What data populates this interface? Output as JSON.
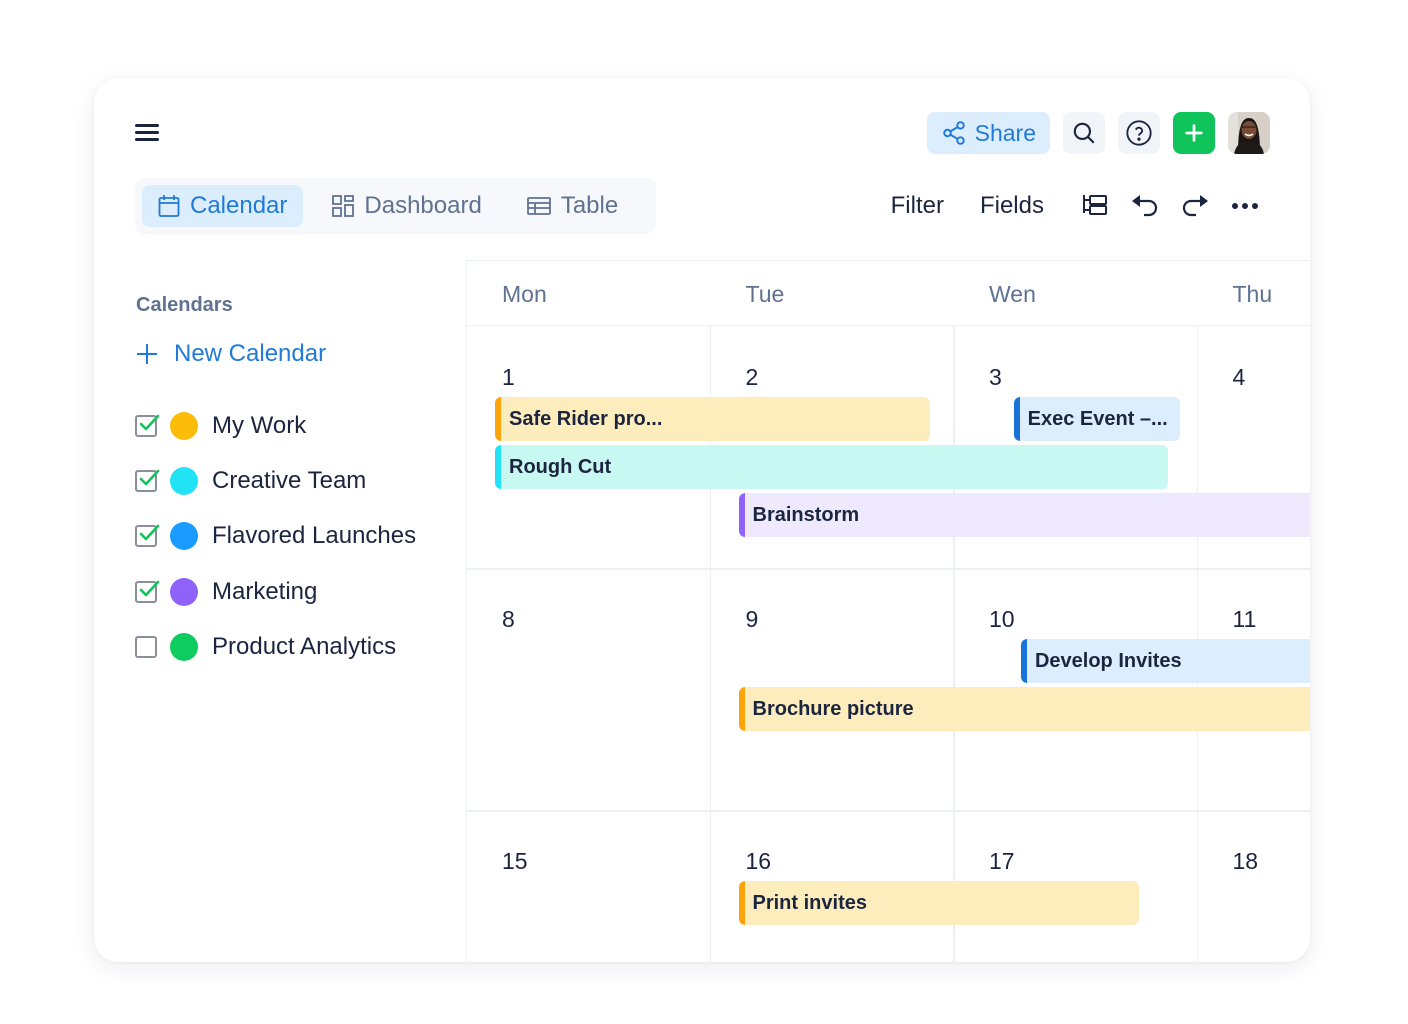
{
  "topbar": {
    "share_label": "Share",
    "icons": [
      "share-icon",
      "search-icon",
      "help-icon",
      "plus-icon",
      "avatar"
    ]
  },
  "views": {
    "tabs": [
      {
        "label": "Calendar",
        "icon": "calendar-icon",
        "active": true
      },
      {
        "label": "Dashboard",
        "icon": "dashboard-icon",
        "active": false
      },
      {
        "label": "Table",
        "icon": "table-icon",
        "active": false
      }
    ]
  },
  "toolbar": {
    "filter_label": "Filter",
    "fields_label": "Fields",
    "icons": [
      "group-icon",
      "undo-icon",
      "redo-icon",
      "more-icon"
    ]
  },
  "sidebar": {
    "heading": "Calendars",
    "new_calendar_label": "New Calendar",
    "calendars": [
      {
        "name": "My Work",
        "color": "#fdbc0a",
        "checked": true
      },
      {
        "name": "Creative Team",
        "color": "#22e3f5",
        "checked": true
      },
      {
        "name": "Flavored Launches",
        "color": "#1a9bff",
        "checked": true
      },
      {
        "name": "Marketing",
        "color": "#8f63f9",
        "checked": true
      },
      {
        "name": "Product Analytics",
        "color": "#0fcc60",
        "checked": false
      }
    ]
  },
  "calendar": {
    "days": [
      "Mon",
      "Tue",
      "Wen",
      "Thu"
    ],
    "weeks": [
      [
        "1",
        "2",
        "3",
        "4"
      ],
      [
        "8",
        "9",
        "10",
        "11"
      ],
      [
        "15",
        "16",
        "17",
        "18"
      ]
    ],
    "events": [
      {
        "title": "Safe Rider pro...",
        "week": 0,
        "start": 0,
        "span": 1.9,
        "lane": 0,
        "bg": "#feedbc",
        "accent": "#fca40a"
      },
      {
        "title": "Exec Event –...",
        "week": 0,
        "start": 2.13,
        "span": 0.8,
        "lane": 0,
        "bg": "#dcedfd",
        "accent": "#1a73d8"
      },
      {
        "title": "Rough Cut",
        "week": 0,
        "start": 0,
        "span": 2.88,
        "lane": 1,
        "bg": "#c8f8f2",
        "accent": "#22e3f5"
      },
      {
        "title": "Brainstorm",
        "week": 0,
        "start": 1.0,
        "span": 3.0,
        "lane": 2,
        "bg": "#eee9fd",
        "accent": "#8f63f9",
        "continues": true
      },
      {
        "title": "Develop Invites",
        "week": 1,
        "start": 2.16,
        "span": 1.84,
        "lane": 0,
        "bg": "#dcedfd",
        "accent": "#1a73d8",
        "continues": true
      },
      {
        "title": "Brochure picture",
        "week": 1,
        "start": 1.0,
        "span": 3.0,
        "lane": 1,
        "bg": "#feedbc",
        "accent": "#fca40a",
        "continues": true
      },
      {
        "title": "Print invites",
        "week": 2,
        "start": 1.0,
        "span": 1.76,
        "lane": 0,
        "bg": "#feedbc",
        "accent": "#fca40a"
      }
    ]
  }
}
